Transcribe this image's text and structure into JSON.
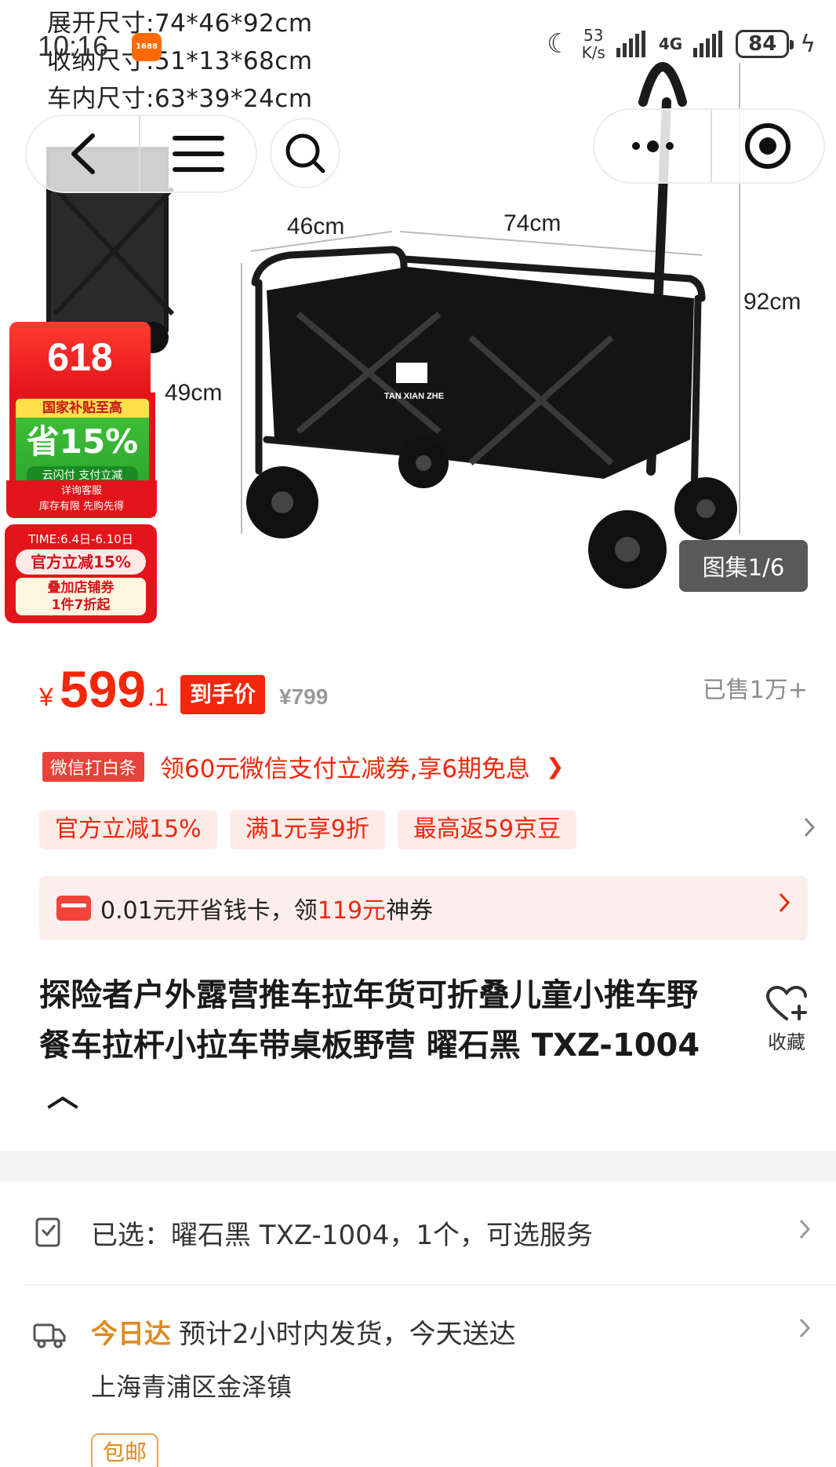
{
  "status_bar": {
    "time": "10:16",
    "app_badge": "1688",
    "net_speed_value": "53",
    "net_speed_unit": "K/s",
    "network": "4G",
    "battery": "84"
  },
  "specs": {
    "line1": "展开尺寸:74*46*92cm",
    "line2": "收纳尺寸:51*13*68cm",
    "line3": "车内尺寸:63*39*24cm"
  },
  "dimensions": {
    "width": "46cm",
    "length": "74cm",
    "height_total": "92cm",
    "height_body": "49cm"
  },
  "brand_logo_text": "TAN XIAN ZHE",
  "promo": {
    "badge_618": "618",
    "subsidy_head": "国家补贴至高",
    "subsidy_big": "省15%",
    "subsidy_small": "云闪付 支付立减",
    "foot_line1": "详询客服",
    "foot_line2": "库存有限 先购先得",
    "time": "TIME:6.4日-6.10日",
    "official": "官方立减15%",
    "stack_line1": "叠加店铺券",
    "stack_line2": "1件7折起"
  },
  "gallery": {
    "label": "图集1/6"
  },
  "price": {
    "currency": "¥",
    "integer": "599",
    "decimal": ".1",
    "tag": "到手价",
    "original": "¥799",
    "sold": "已售1万+"
  },
  "wechat": {
    "badge": "微信打白条",
    "text": "领60元微信支付立减券,享6期免息",
    "arrow": "❯"
  },
  "coupons": [
    "官方立减15%",
    "满1元享9折",
    "最高返59京豆"
  ],
  "savecard": {
    "prefix": "0.01元开省钱卡，领",
    "amount": "119元",
    "suffix": "神券"
  },
  "title": {
    "text": "探险者户外露营推车拉年货可折叠儿童小推车野餐车拉杆小拉车带桌板野营 曜石黑 TXZ-1004",
    "collapse": "︿"
  },
  "favorite": {
    "label": "收藏"
  },
  "selected": {
    "text": "已选：曜石黑 TXZ-1004，1个，可选服务"
  },
  "delivery": {
    "today": "今日达",
    "text": "预计2小时内发货，今天送达",
    "address": "上海青浦区金泽镇",
    "free_shipping": "包邮"
  },
  "colors": {
    "accent_red": "#f2270c",
    "today_orange": "#e08a1e"
  }
}
